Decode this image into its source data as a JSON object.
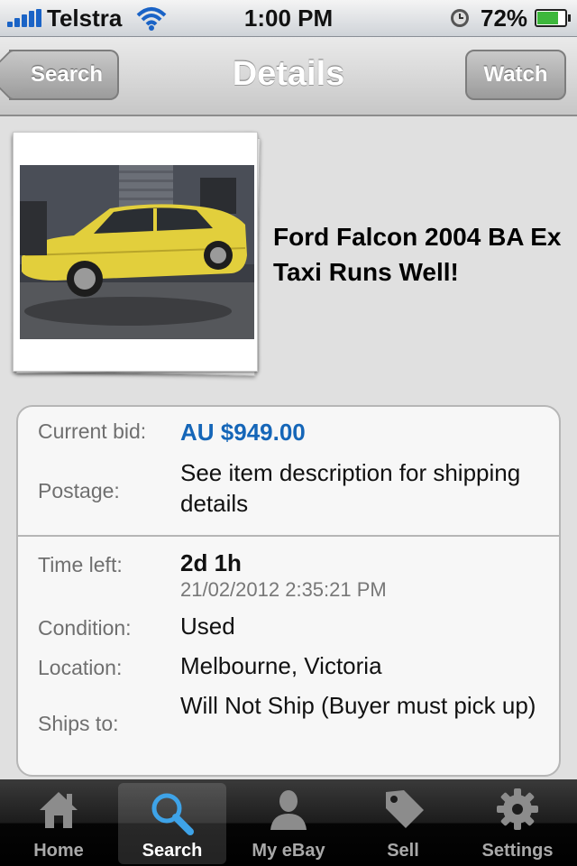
{
  "status_bar": {
    "carrier": "Telstra",
    "time": "1:00 PM",
    "battery_percent": "72%",
    "battery_level": 0.72
  },
  "nav": {
    "back_label": "Search",
    "title": "Details",
    "watch_label": "Watch"
  },
  "item": {
    "title": "Ford Falcon 2004 BA Ex Taxi Runs Well!"
  },
  "details": {
    "current_bid_label": "Current bid:",
    "current_bid_value": "AU $949.00",
    "postage_label": "Postage:",
    "postage_value": "See item description for shipping details",
    "time_left_label": "Time left:",
    "time_left_value": "2d 1h",
    "end_date": "21/02/2012 2:35:21 PM",
    "condition_label": "Condition:",
    "condition_value": "Used",
    "location_label": "Location:",
    "location_value": "Melbourne, Victoria",
    "ships_to_label": "Ships to:",
    "ships_to_value": "Will Not Ship (Buyer must pick up)"
  },
  "tabs": [
    {
      "label": "Home",
      "icon": "home-icon"
    },
    {
      "label": "Search",
      "icon": "search-icon",
      "active": true
    },
    {
      "label": "My eBay",
      "icon": "person-icon"
    },
    {
      "label": "Sell",
      "icon": "tag-icon"
    },
    {
      "label": "Settings",
      "icon": "gear-icon"
    }
  ],
  "colors": {
    "bid_blue": "#1566b8",
    "battery_green": "#3db73c",
    "signal_blue": "#1a63c6"
  }
}
